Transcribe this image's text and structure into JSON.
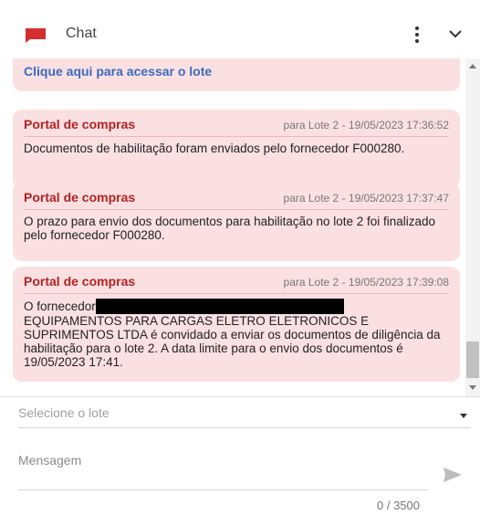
{
  "header": {
    "title": "Chat",
    "icon": "chat-flag-icon",
    "accent": "#d32f2f"
  },
  "messages": {
    "top_link": "Clique aqui para acessar o lote",
    "items": [
      {
        "sender": "Portal de compras",
        "meta": "para Lote 2 - 19/05/2023 17:36:52",
        "body": "Documentos de habilitação foram enviados pelo fornecedor F000280."
      },
      {
        "sender": "Portal de compras",
        "meta": "para Lote 2 - 19/05/2023 17:37:47",
        "body": "O prazo para envio dos documentos para habilitação no lote 2 foi finalizado pelo fornecedor F000280."
      },
      {
        "sender": "Portal de compras",
        "meta": "para Lote 2 - 19/05/2023 17:39:08",
        "body_prefix": "O fornecedor",
        "body_rest": "EQUIPAMENTOS PARA CARGAS ELETRO ELETRONICOS E SUPRIMENTOS LTDA é convidado a enviar os documentos de diligência da habilitação para o lote 2. A data limite para o envio dos documentos é 19/05/2023 17:41."
      }
    ]
  },
  "footer": {
    "lot_placeholder": "Selecione o lote",
    "message_placeholder": "Mensagem",
    "counter": "0 / 3500"
  },
  "colors": {
    "card_bg": "#fbe0e2",
    "sender": "#b22222",
    "link": "#3a6bbf"
  }
}
